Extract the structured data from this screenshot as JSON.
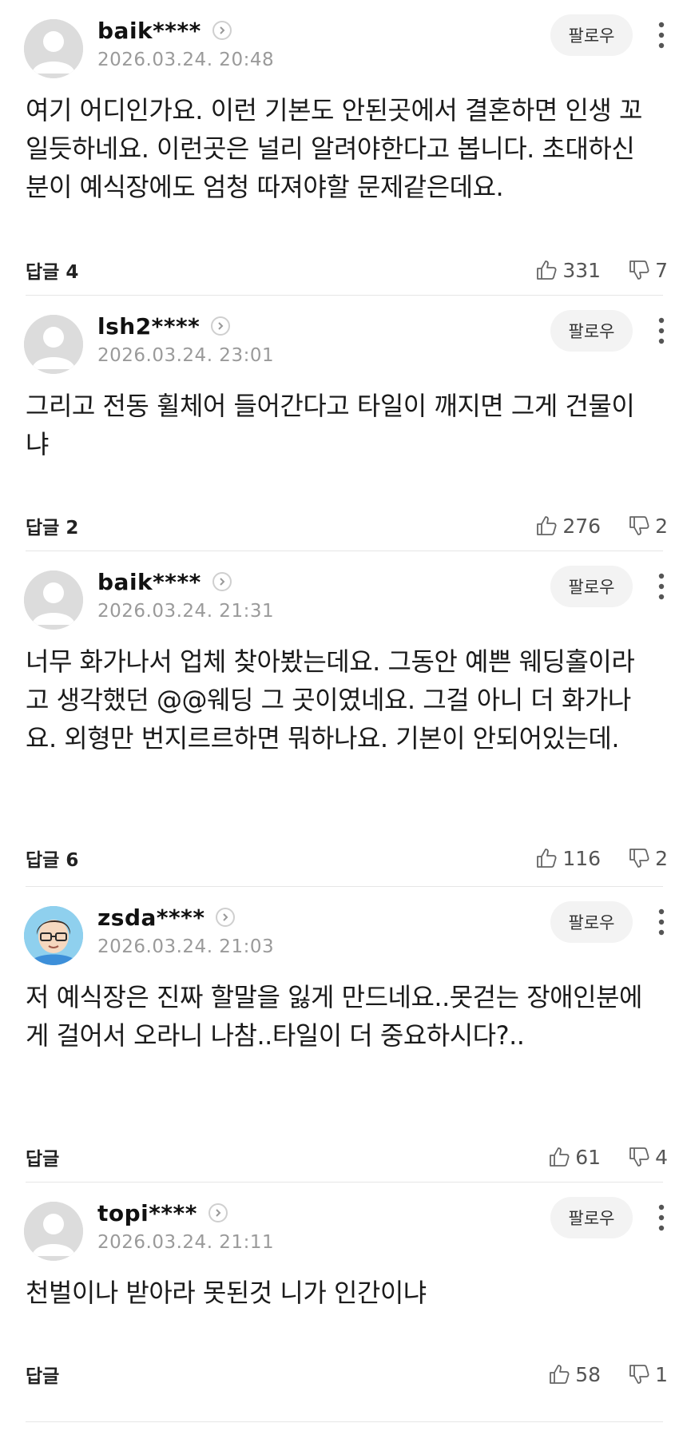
{
  "follow_label": "팔로우",
  "comments": [
    {
      "username": "baik****",
      "timestamp": "2026.03.24. 20:48",
      "text": "여기 어디인가요. 이런 기본도 안된곳에서 결혼하면 인생 꼬일듯하네요. 이런곳은 널리 알려야한다고 봅니다. 초대하신분이 예식장에도 엄청 따져야할 문제같은데요.",
      "reply_label": "답글 4",
      "likes": "331",
      "dislikes": "7",
      "avatar": "default-avatar"
    },
    {
      "username": "lsh2****",
      "timestamp": "2026.03.24. 23:01",
      "text": "그리고 전동 휠체어 들어간다고 타일이 깨지면 그게 건물이냐",
      "reply_label": "답글 2",
      "likes": "276",
      "dislikes": "2",
      "avatar": "default-avatar"
    },
    {
      "username": "baik****",
      "timestamp": "2026.03.24. 21:31",
      "text": "너무 화가나서 업체 찾아봤는데요. 그동안 예쁜 웨딩홀이라고 생각했던 @@웨딩 그 곳이였네요. 그걸 아니 더 화가나요. 외형만 번지르르하면 뭐하나요. 기본이 안되어있는데.",
      "reply_label": "답글 6",
      "likes": "116",
      "dislikes": "2",
      "avatar": "default-avatar"
    },
    {
      "username": "zsda****",
      "timestamp": "2026.03.24. 21:03",
      "text": "저 예식장은 진짜 할말을 잃게 만드네요..못걷는 장애인분에게 걸어서 오라니 나참..타일이 더 중요하시다?..",
      "reply_label": "답글",
      "likes": "61",
      "dislikes": "4",
      "avatar": "cartoon-avatar"
    },
    {
      "username": "topi****",
      "timestamp": "2026.03.24. 21:11",
      "text": "천벌이나 받아라 못된것 니가 인간이냐",
      "reply_label": "답글",
      "likes": "58",
      "dislikes": "1",
      "avatar": "default-avatar"
    }
  ]
}
